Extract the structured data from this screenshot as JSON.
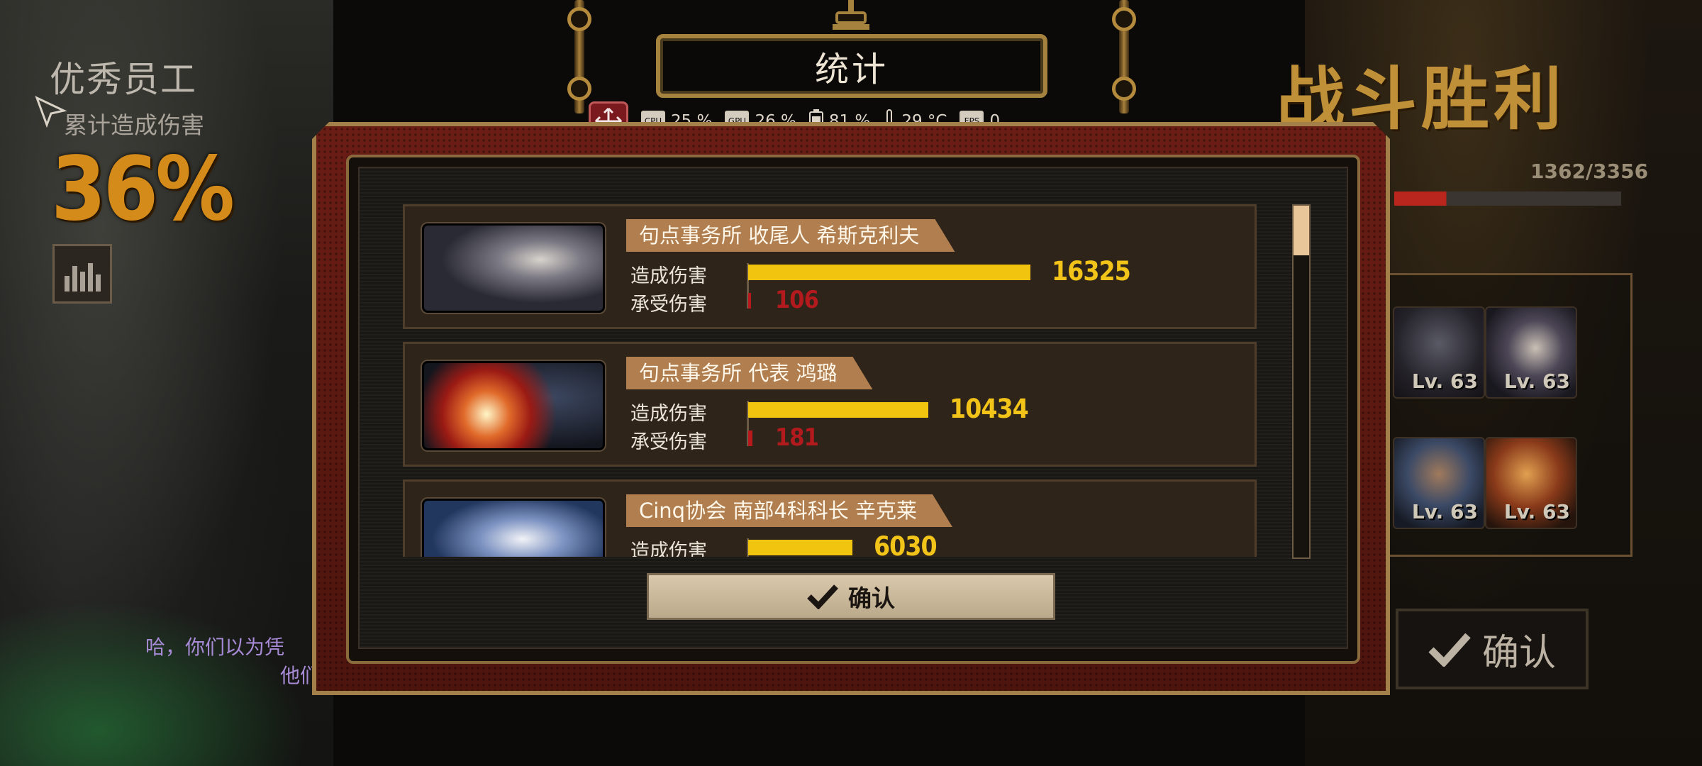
{
  "background": {
    "left_hud": {
      "title": "优秀员工",
      "subtitle": "累计造成伤害",
      "percent": "36%",
      "dialog_line1": "哈，你们以为凭",
      "dialog_line2": "他们"
    },
    "right_hud": {
      "victory": "战斗胜利",
      "exp_text": "1362/3356",
      "exp_fraction": 0.41,
      "team_levels": [
        "Lv. 63",
        "Lv. 63",
        "Lv. 63",
        "Lv. 63"
      ],
      "confirm_label": "确认"
    }
  },
  "modal": {
    "title": "统计",
    "perf": {
      "cpu1": "25 %",
      "cpu2": "26 %",
      "battery": "81 %",
      "temp": "29 °C",
      "fps": "0",
      "cpu1_chip": "CPU",
      "cpu2_chip": "GPU",
      "fps_chip": "FPS"
    },
    "labels": {
      "dealt": "造成伤害",
      "taken": "承受伤害"
    },
    "rows": [
      {
        "name": "句点事务所 收尾人 希斯克利夫",
        "dealt": "16325",
        "taken": "106"
      },
      {
        "name": "句点事务所 代表 鸿璐",
        "dealt": "10434",
        "taken": "181"
      },
      {
        "name": "Cinq协会 南部4科科长 辛克莱",
        "dealt": "6030",
        "taken": ""
      }
    ],
    "confirm_label": "确认"
  },
  "colors": {
    "damage_bar": "#f1c40f",
    "taken_bar": "#b8191c",
    "frame": "#a3804a"
  }
}
